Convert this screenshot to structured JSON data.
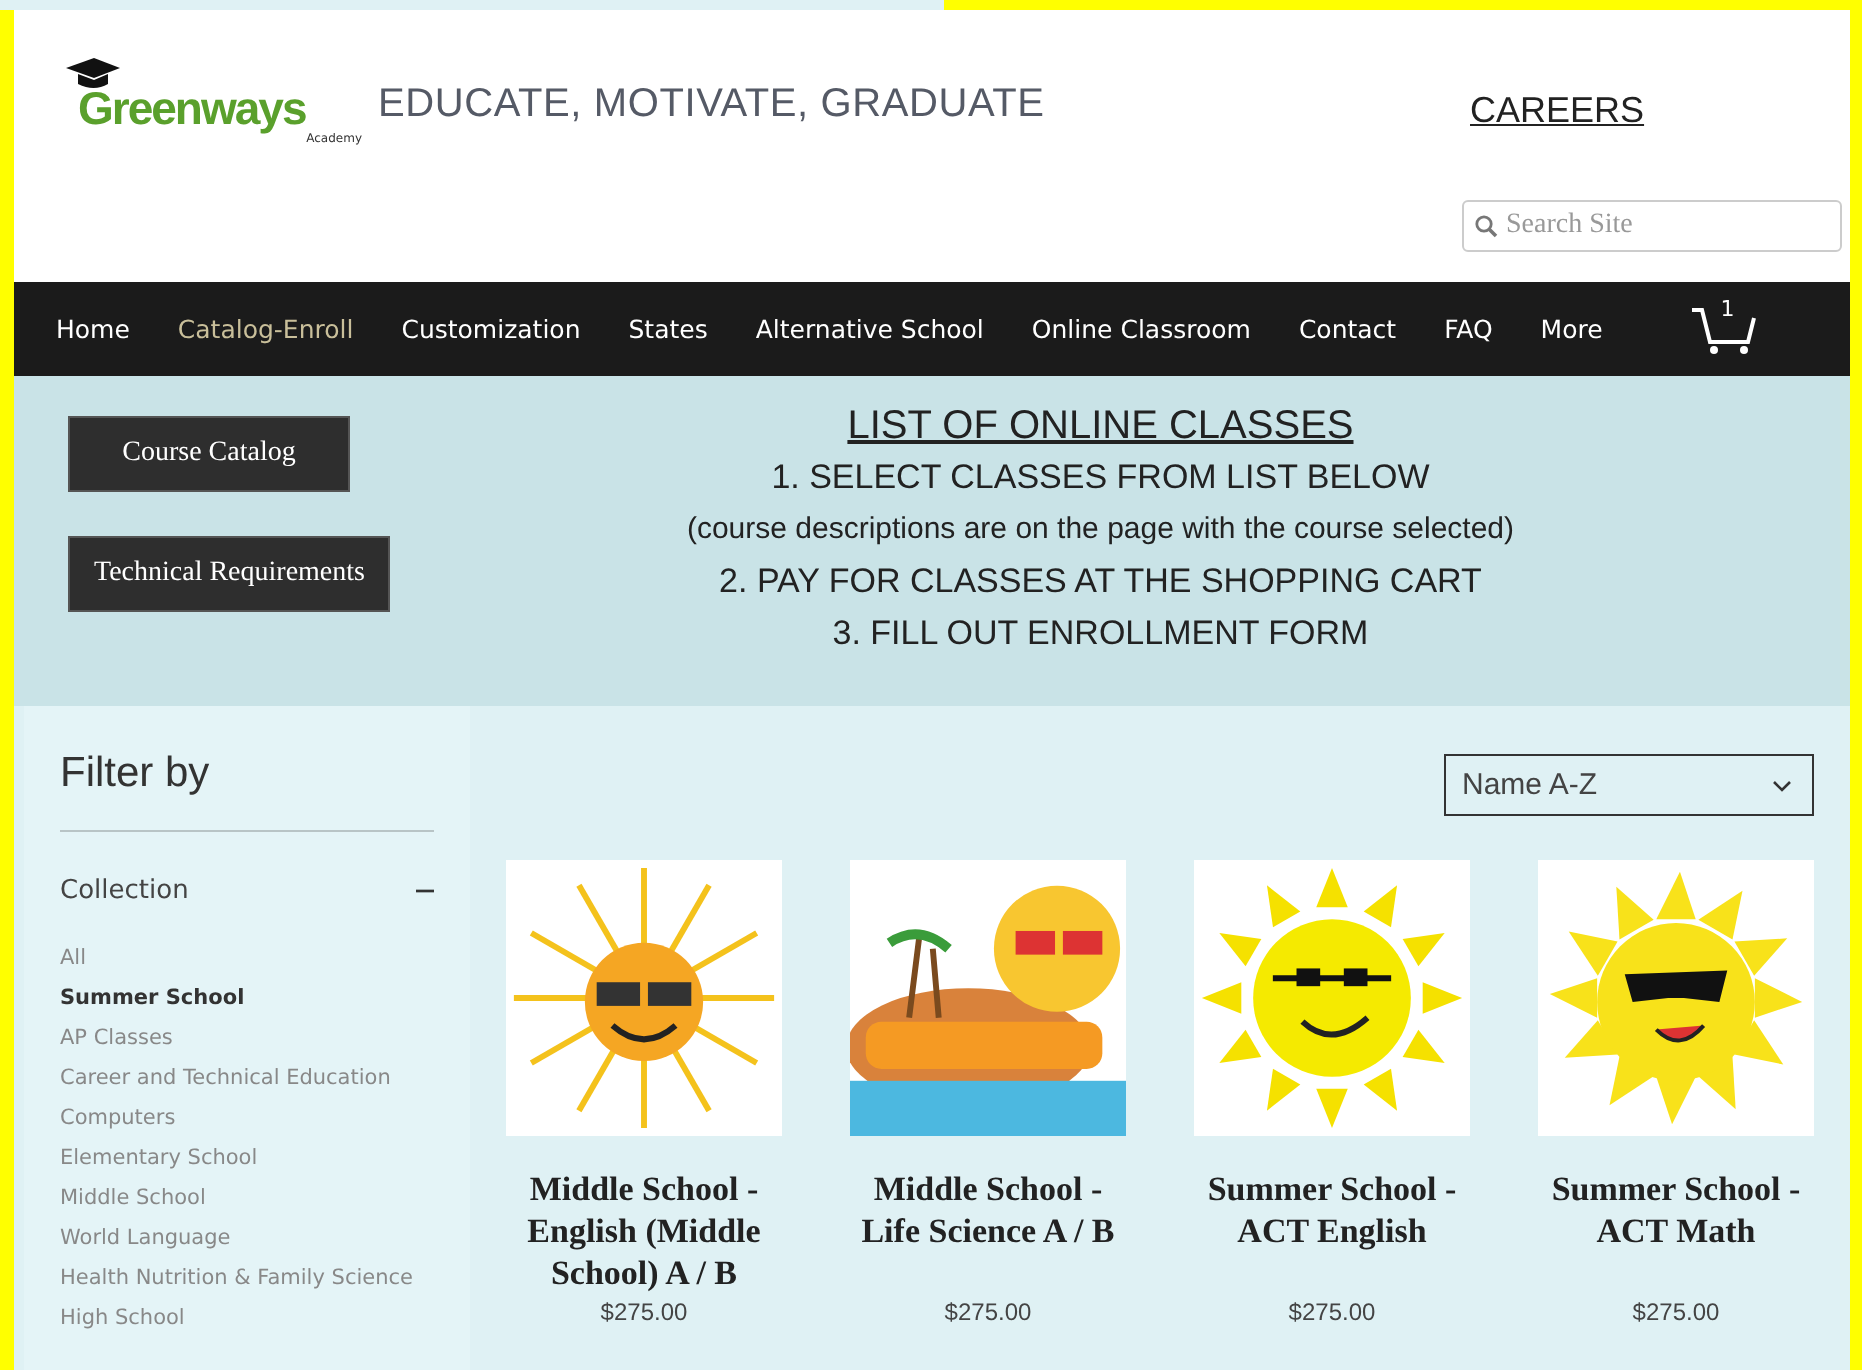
{
  "header": {
    "logo": {
      "name": "Greenways",
      "sub": "Academy"
    },
    "tagline": "EDUCATE, MOTIVATE, GRADUATE",
    "careers_link": "CAREERS",
    "search": {
      "placeholder": "Search Site"
    }
  },
  "nav": {
    "items": [
      {
        "label": "Home",
        "selected": false
      },
      {
        "label": "Catalog-Enroll",
        "selected": true
      },
      {
        "label": "Customization",
        "selected": false
      },
      {
        "label": "States",
        "selected": false
      },
      {
        "label": "Alternative School",
        "selected": false
      },
      {
        "label": "Online Classroom",
        "selected": false
      },
      {
        "label": "Contact",
        "selected": false
      },
      {
        "label": "FAQ",
        "selected": false
      },
      {
        "label": "More",
        "selected": false
      }
    ],
    "cart_count": "1"
  },
  "banner": {
    "buttons": [
      "Course Catalog",
      "Technical Requirements"
    ],
    "title": "LIST OF ONLINE CLASSES",
    "lines": [
      "1. SELECT CLASSES FROM LIST BELOW",
      "(course descriptions are on the page with the course selected)",
      "2. PAY FOR CLASSES AT THE SHOPPING CART",
      "3. FILL OUT ENROLLMENT FORM"
    ]
  },
  "filter": {
    "title": "Filter by",
    "section": "Collection",
    "expanded": true,
    "items": [
      {
        "label": "All",
        "selected": false
      },
      {
        "label": "Summer School",
        "selected": true
      },
      {
        "label": "AP Classes",
        "selected": false
      },
      {
        "label": "Career and Technical Education",
        "selected": false
      },
      {
        "label": "Computers",
        "selected": false
      },
      {
        "label": "Elementary School",
        "selected": false
      },
      {
        "label": "Middle School",
        "selected": false
      },
      {
        "label": "World Language",
        "selected": false
      },
      {
        "label": "Health Nutrition & Family Science",
        "selected": false
      },
      {
        "label": "High School",
        "selected": false
      }
    ]
  },
  "sort": {
    "value": "Name A-Z"
  },
  "products": [
    {
      "kind": "sun-glasses",
      "name": "Middle School - English (Middle School) A / B",
      "price": "$275.00"
    },
    {
      "kind": "island",
      "name": "Middle School - Life Science A / B",
      "price": "$275.00"
    },
    {
      "kind": "sun-triangles",
      "name": "Summer School - ACT English",
      "price": "$275.00"
    },
    {
      "kind": "sun-wavy",
      "name": "Summer School - ACT Math",
      "price": "$275.00"
    }
  ]
}
